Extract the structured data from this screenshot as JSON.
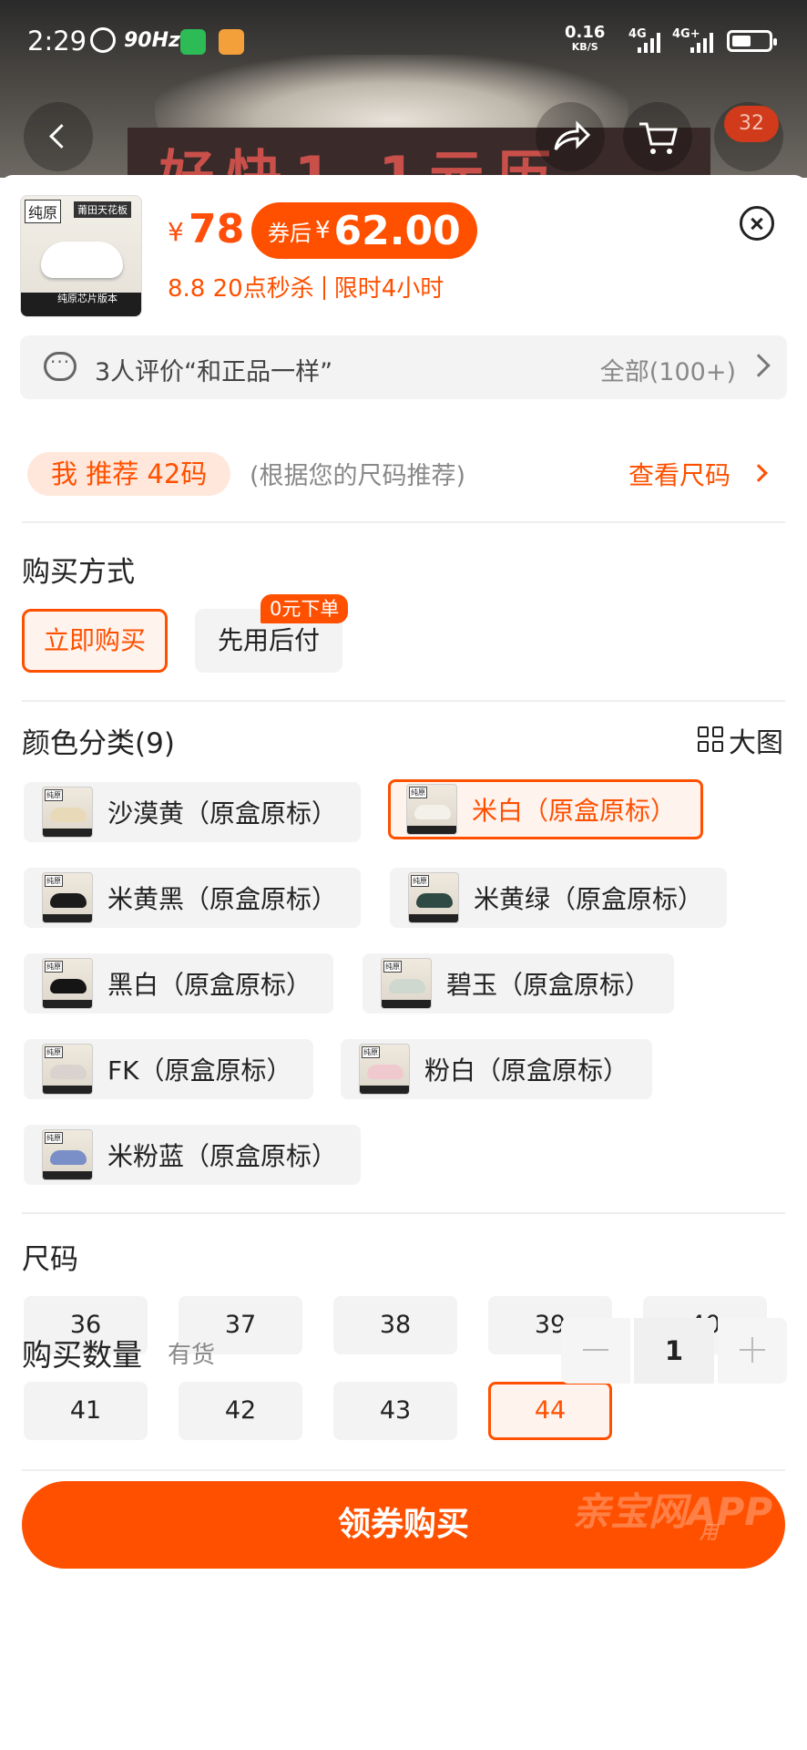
{
  "status_bar": {
    "time": "2:29",
    "refresh": "90Hz",
    "net_speed_value": "0.16",
    "net_speed_unit": "KB/S",
    "sig1": "4G",
    "sig2": "4G+"
  },
  "background": {
    "banner_text": "好快1.1元历"
  },
  "header": {
    "cart_count": "32"
  },
  "product": {
    "thumb_tag": "纯原",
    "thumb_tag2": "莆田天花板",
    "thumb_footer": "纯原芯片版本",
    "price_symbol": "¥",
    "price": "78",
    "coupon_label": "券后",
    "coupon_symbol": "¥",
    "coupon_price": "62.00",
    "promo_left": "8.8 20点秒杀",
    "promo_right": "限时4小时"
  },
  "reviews": {
    "summary": "3人评价“和正品一样”",
    "all": "全部(100+)"
  },
  "recommend": {
    "pill": "我 推荐 42码",
    "note": "(根据您的尺码推荐)",
    "link": "查看尺码"
  },
  "purchase_method": {
    "title": "购买方式",
    "options": [
      "立即购买",
      "先用后付"
    ],
    "badge": "0元下单"
  },
  "colors": {
    "title": "颜色分类(9)",
    "big_image": "大图",
    "items": [
      {
        "label": "沙漠黄（原盒原标）",
        "shoe_color": "#e8d9b8"
      },
      {
        "label": "米白（原盒原标）",
        "shoe_color": "#f4f1ea"
      },
      {
        "label": "米黄黑（原盒原标）",
        "shoe_color": "#1b1b1b"
      },
      {
        "label": "米黄绿（原盒原标）",
        "shoe_color": "#2f4a45"
      },
      {
        "label": "黑白（原盒原标）",
        "shoe_color": "#151515"
      },
      {
        "label": "碧玉（原盒原标）",
        "shoe_color": "#cfd8cf"
      },
      {
        "label": "FK（原盒原标）",
        "shoe_color": "#d9d3d0"
      },
      {
        "label": "粉白（原盒原标）",
        "shoe_color": "#f0c9cf"
      },
      {
        "label": "米粉蓝（原盒原标）",
        "shoe_color": "#7a8fc7"
      }
    ],
    "selected_index": 1
  },
  "sizes": {
    "title": "尺码",
    "items": [
      "36",
      "37",
      "38",
      "39",
      "40",
      "41",
      "42",
      "43",
      "44"
    ],
    "selected": "44"
  },
  "quantity": {
    "label": "购买数量",
    "stock": "有货",
    "value": "1"
  },
  "cta": {
    "label": "领券购买"
  },
  "watermark": {
    "line1": "亲宝网APP",
    "line2": "用"
  },
  "accent_color": "#ff5000"
}
